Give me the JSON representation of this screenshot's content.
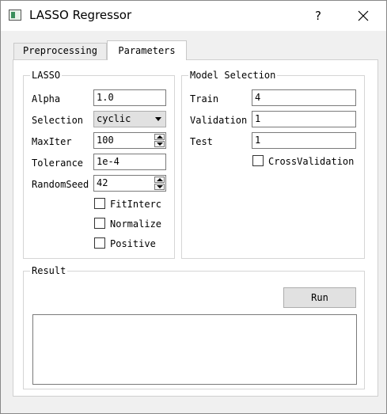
{
  "window": {
    "title": "LASSO Regressor",
    "help_label": "?"
  },
  "tabs": [
    {
      "label": "Preprocessing",
      "active": false
    },
    {
      "label": "Parameters",
      "active": true
    }
  ],
  "lasso": {
    "title": "LASSO",
    "alpha_label": "Alpha",
    "alpha_value": "1.0",
    "selection_label": "Selection",
    "selection_value": "cyclic",
    "maxiter_label": "MaxIter",
    "maxiter_value": "100",
    "tolerance_label": "Tolerance",
    "tolerance_value": "1e-4",
    "randomseed_label": "RandomSeed",
    "randomseed_value": "42",
    "fit_intercept_label": "FitInterc",
    "normalize_label": "Normalize",
    "positive_label": "Positive"
  },
  "model_selection": {
    "title": "Model Selection",
    "train_label": "Train",
    "train_value": "4",
    "validation_label": "Validation",
    "validation_value": "1",
    "test_label": "Test",
    "test_value": "1",
    "cross_validation_label": "CrossValidation"
  },
  "result": {
    "title": "Result",
    "run_label": "Run",
    "output_text": ""
  },
  "icons": {
    "app": "app-window-icon",
    "close": "close-icon"
  }
}
